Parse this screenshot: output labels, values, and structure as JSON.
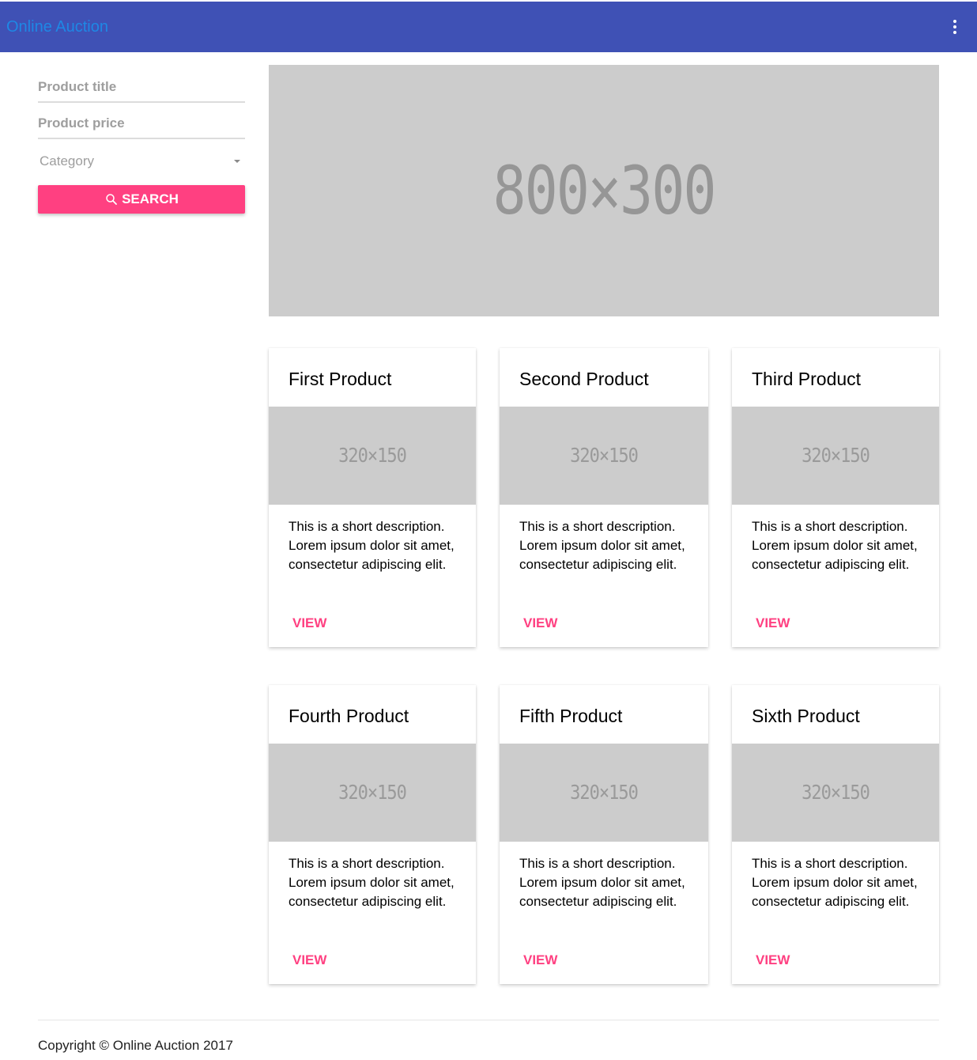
{
  "toolbar": {
    "title": "Online Auction",
    "menu_icon": "more-vert-icon",
    "background": "#3f51b5",
    "title_color": "#1e88e5"
  },
  "search_form": {
    "title_placeholder": "Product title",
    "price_placeholder": "Product price",
    "category_placeholder": "Category",
    "search_label": "SEARCH",
    "search_icon": "search-icon",
    "accent": "#ff4081"
  },
  "hero": {
    "placeholder_text": "800×300"
  },
  "products": [
    {
      "title": "First Product",
      "image_text": "320×150",
      "description": "This is a short description. Lorem ipsum dolor sit amet, consectetur adipiscing elit.",
      "action": "VIEW"
    },
    {
      "title": "Second Product",
      "image_text": "320×150",
      "description": "This is a short description. Lorem ipsum dolor sit amet, consectetur adipiscing elit.",
      "action": "VIEW"
    },
    {
      "title": "Third Product",
      "image_text": "320×150",
      "description": "This is a short description. Lorem ipsum dolor sit amet, consectetur adipiscing elit.",
      "action": "VIEW"
    },
    {
      "title": "Fourth Product",
      "image_text": "320×150",
      "description": "This is a short description. Lorem ipsum dolor sit amet, consectetur adipiscing elit.",
      "action": "VIEW"
    },
    {
      "title": "Fifth Product",
      "image_text": "320×150",
      "description": "This is a short description. Lorem ipsum dolor sit amet, consectetur adipiscing elit.",
      "action": "VIEW"
    },
    {
      "title": "Sixth Product",
      "image_text": "320×150",
      "description": "This is a short description. Lorem ipsum dolor sit amet, consectetur adipiscing elit.",
      "action": "VIEW"
    }
  ],
  "footer": {
    "copyright": "Copyright © Online Auction 2017"
  }
}
